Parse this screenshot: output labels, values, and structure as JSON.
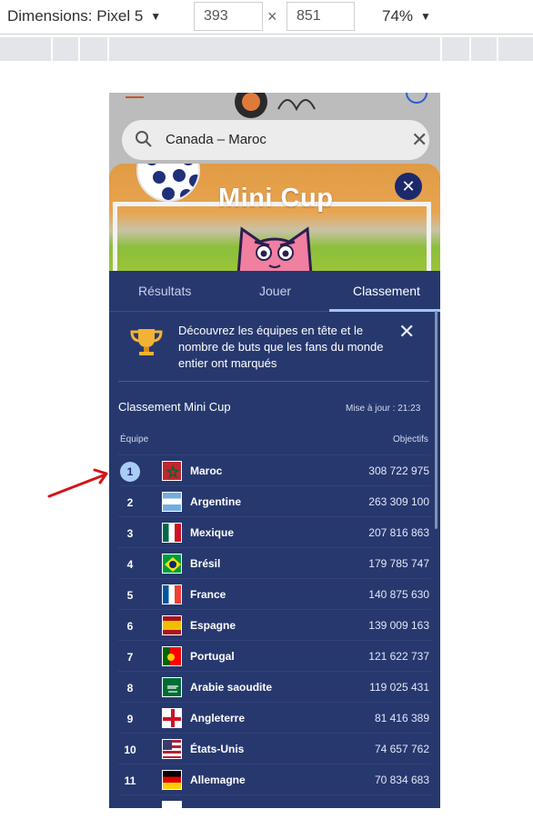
{
  "devtools": {
    "dimensions_label": "Dimensions: Pixel 5",
    "width": "393",
    "height": "851",
    "times": "×",
    "zoom": "74%"
  },
  "search": {
    "query": "Canada – Maroc",
    "clear_icon": "close-icon"
  },
  "banner": {
    "title": "Mini Cup",
    "close_label": "✕"
  },
  "tabs": [
    {
      "label": "Résultats",
      "active": false
    },
    {
      "label": "Jouer",
      "active": false
    },
    {
      "label": "Classement",
      "active": true
    }
  ],
  "notice": {
    "text": "Découvrez les équipes en tête et le nombre de buts que les fans du monde entier ont marqués",
    "close": "✕"
  },
  "leaderboard": {
    "title": "Classement Mini Cup",
    "updated": "Mise à jour : 21:23",
    "col_team": "Équipe",
    "col_goals": "Objectifs",
    "rows": [
      {
        "rank": "1",
        "team": "Maroc",
        "goals": "308 722 975"
      },
      {
        "rank": "2",
        "team": "Argentine",
        "goals": "263 309 100"
      },
      {
        "rank": "3",
        "team": "Mexique",
        "goals": "207 816 863"
      },
      {
        "rank": "4",
        "team": "Brésil",
        "goals": "179 785 747"
      },
      {
        "rank": "5",
        "team": "France",
        "goals": "140 875 630"
      },
      {
        "rank": "6",
        "team": "Espagne",
        "goals": "139 009 163"
      },
      {
        "rank": "7",
        "team": "Portugal",
        "goals": "121 622 737"
      },
      {
        "rank": "8",
        "team": "Arabie saoudite",
        "goals": "119 025 431"
      },
      {
        "rank": "9",
        "team": "Angleterre",
        "goals": "81 416 389"
      },
      {
        "rank": "10",
        "team": "États-Unis",
        "goals": "74 657 762"
      },
      {
        "rank": "11",
        "team": "Allemagne",
        "goals": "70 834 683"
      }
    ]
  },
  "colors": {
    "panel": "#27386f",
    "accent": "#9ec4ff",
    "annotation": "#d2141a"
  }
}
